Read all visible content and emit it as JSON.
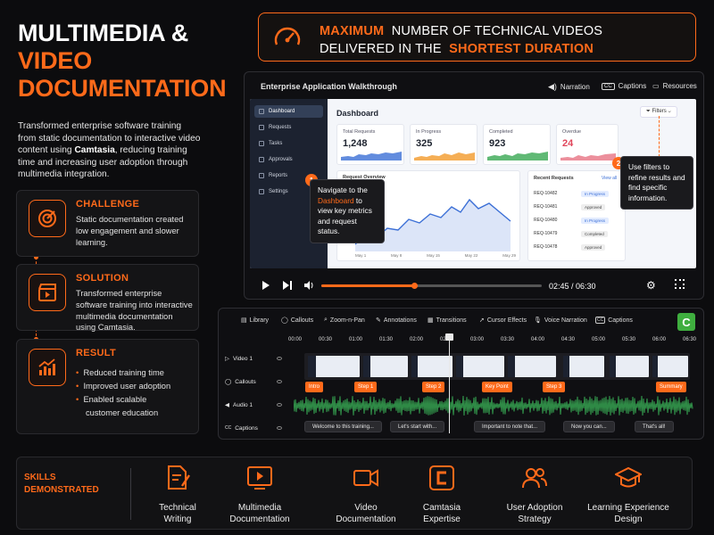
{
  "hero": {
    "title_line1": "MULTIMEDIA &",
    "title_line2": "VIDEO",
    "title_line3": "DOCUMENTATION",
    "intro_pre": "Transformed enterprise software training from static documentation to interactive video content using ",
    "intro_bold": "Camtasia",
    "intro_post": ", reducing training time and increasing user adoption through multimedia integration."
  },
  "cards": {
    "challenge": {
      "heading": "CHALLENGE",
      "text": "Static documentation created low engagement and slower learning."
    },
    "solution": {
      "heading": "SOLUTION",
      "text": "Transformed enterprise software training into interactive multimedia documentation using Camtasia."
    },
    "result": {
      "heading": "RESULT",
      "items": [
        "Reduced training time",
        "Improved user adoption",
        "Enabled scalable customer education"
      ]
    }
  },
  "banner": {
    "w1": "MAXIMUM",
    "w2": "NUMBER OF TECHNICAL VIDEOS",
    "w3": "DELIVERED IN THE",
    "w4": "SHORTEST DURATION"
  },
  "player": {
    "title": "Enterprise Application Walkthrough",
    "controls": [
      "Narration",
      "Captions",
      "Resources"
    ],
    "time": "02:45 / 06:30",
    "progress": 0.42,
    "app": {
      "sidebar": [
        "Dashboard",
        "Requests",
        "Tasks",
        "Approvals",
        "Reports",
        "Settings"
      ],
      "heading": "Dashboard",
      "filters": "Filters",
      "kpis": [
        {
          "label": "Total Requests",
          "value": "1,248",
          "color": "#3b6fd6"
        },
        {
          "label": "In Progress",
          "value": "325",
          "color": "#f39a2b"
        },
        {
          "label": "Completed",
          "value": "923",
          "color": "#38a852"
        },
        {
          "label": "Overdue",
          "value": "24",
          "color": "#e0455a"
        }
      ],
      "chart_title": "Request Overview",
      "chart_x": [
        "May 1",
        "May 8",
        "May 15",
        "May 22",
        "May 29"
      ],
      "recent_title": "Recent Requests",
      "view_all": "View all",
      "requests": [
        {
          "id": "REQ-10482",
          "status": "In Progress"
        },
        {
          "id": "REQ-10481",
          "status": "Approved"
        },
        {
          "id": "REQ-10480",
          "status": "In Progress"
        },
        {
          "id": "REQ-10479",
          "status": "Completed"
        },
        {
          "id": "REQ-10478",
          "status": "Approved"
        }
      ]
    },
    "tip1": {
      "num": "1",
      "pre": "Navigate to the ",
      "hl": "Dashboard",
      "post": " to view key metrics and request status."
    },
    "tip2": {
      "num": "2",
      "text": "Use filters to refine results and find specific information."
    }
  },
  "editor": {
    "tools": [
      "Library",
      "Callouts",
      "Zoom-n-Pan",
      "Annotations",
      "Transitions",
      "Cursor Effects",
      "Voice Narration",
      "Captions"
    ],
    "ticks": [
      "00:00",
      "00:30",
      "01:00",
      "01:30",
      "02:00",
      "02:30",
      "03:00",
      "03:30",
      "04:00",
      "04:30",
      "05:00",
      "05:30",
      "06:00",
      "06:30"
    ],
    "tracks": [
      "Video 1",
      "Callouts",
      "Audio 1",
      "Captions"
    ],
    "markers": [
      "Intro",
      "Step 1",
      "Step 2",
      "Key Point",
      "Step 3",
      "Summary"
    ],
    "captions": [
      "Welcome to this training...",
      "Let's start with...",
      "Important to note that...",
      "Now you can...",
      "That's all!"
    ]
  },
  "skills": {
    "heading_line1": "SKILLS",
    "heading_line2": "DEMONSTRATED",
    "items": [
      {
        "l1": "Technical",
        "l2": "Writing"
      },
      {
        "l1": "Multimedia",
        "l2": "Documentation"
      },
      {
        "l1": "Video",
        "l2": "Documentation"
      },
      {
        "l1": "Camtasia",
        "l2": "Expertise"
      },
      {
        "l1": "User Adoption",
        "l2": "Strategy"
      },
      {
        "l1": "Learning Experience",
        "l2": "Design"
      }
    ]
  },
  "colors": {
    "accent": "#ff6a1a",
    "background": "#0c0c0e"
  }
}
